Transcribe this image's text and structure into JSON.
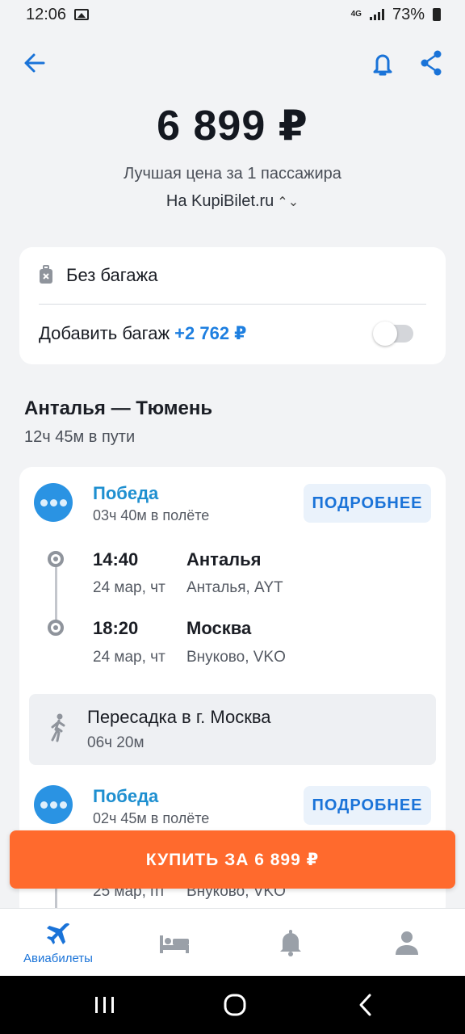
{
  "status_bar": {
    "time": "12:06",
    "network": "4G",
    "battery": "73%"
  },
  "header": {
    "price": "6 899 ₽",
    "price_caption": "Лучшая цена за 1 пассажира",
    "vendor": "На KupiBilet.ru"
  },
  "baggage": {
    "no_baggage_label": "Без багажа",
    "add_label": "Добавить багаж",
    "add_price": "+2 762 ₽",
    "toggle_on": false
  },
  "route": {
    "title": "Анталья — Тюмень",
    "total_duration": "12ч 45м в пути"
  },
  "flights": [
    {
      "airline": "Победа",
      "duration": "03ч 40м в полёте",
      "details_label": "ПОДРОБНЕЕ",
      "departure": {
        "time": "14:40",
        "date": "24 мар, чт",
        "city": "Анталья",
        "airport": "Анталья, AYT"
      },
      "arrival": {
        "time": "18:20",
        "date": "24 мар, чт",
        "city": "Москва",
        "airport": "Внуково, VKO"
      }
    },
    {
      "airline": "Победа",
      "duration": "02ч 45м в полёте",
      "details_label": "ПОДРОБНЕЕ",
      "departure": {
        "date": "25 мар, пт",
        "airport": "Внуково, VKO"
      }
    }
  ],
  "transfer": {
    "title": "Пересадка в г. Москва",
    "duration": "06ч 20м"
  },
  "buy_button": "КУПИТЬ ЗА 6 899 ₽",
  "bottom_nav": {
    "items": [
      {
        "label": "Авиабилеты",
        "icon": "airplane-icon",
        "active": true
      },
      {
        "icon": "hotel-bed-icon"
      },
      {
        "icon": "bell-icon"
      },
      {
        "icon": "profile-icon"
      }
    ]
  },
  "colors": {
    "accent": "#1e7fe0",
    "buy": "#ff6a2d",
    "airline": "#2a93e3"
  }
}
